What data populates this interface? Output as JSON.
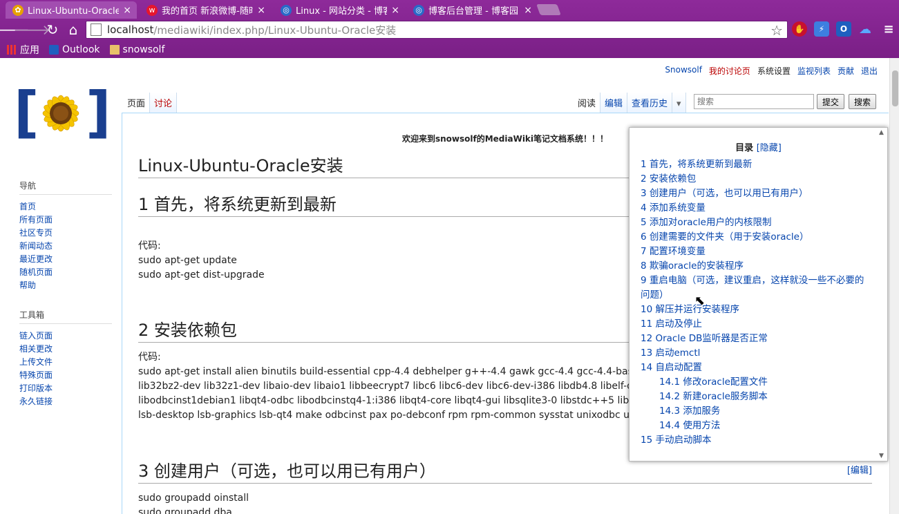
{
  "browser": {
    "tabs": [
      {
        "title": "Linux-Ubuntu-Oracle安装",
        "active": true,
        "icon": "mediawiki-sunflower-icon",
        "color": "#e6a100"
      },
      {
        "title": "我的首页 新浪微博-随时随地",
        "active": false,
        "icon": "weibo-icon",
        "color": "#e6162d"
      },
      {
        "title": "Linux - 网站分类 - 博客园",
        "active": false,
        "icon": "cnblogs-icon",
        "color": "#2a6ac8"
      },
      {
        "title": "博客后台管理 - 博客园",
        "active": false,
        "icon": "cnblogs-icon",
        "color": "#2a6ac8"
      }
    ],
    "url_host": "localhost",
    "url_path": "/mediawiki/index.php/Linux-Ubuntu-Oracle安装",
    "bookmarks": [
      "应用",
      "Outlook",
      "snowsolf"
    ],
    "accent": "#7a1f86"
  },
  "personal": {
    "user": "Snowsolf",
    "talk": "我的讨论页",
    "prefs": "系统设置",
    "watch": "监视列表",
    "contrib": "贡献",
    "logout": "退出"
  },
  "tabs": {
    "page": "页面",
    "talk": "讨论",
    "read": "阅读",
    "edit": "编辑",
    "history": "查看历史"
  },
  "search": {
    "placeholder": "搜索",
    "go": "提交",
    "search": "搜索"
  },
  "nav": {
    "heading": "导航",
    "items": [
      "首页",
      "所有页面",
      "社区专页",
      "新闻动态",
      "最近更改",
      "随机页面",
      "帮助"
    ]
  },
  "toolbox": {
    "heading": "工具箱",
    "items": [
      "链入页面",
      "相关更改",
      "上传文件",
      "特殊页面",
      "打印版本",
      "永久链接"
    ]
  },
  "article": {
    "sitenotice": "欢迎来到snowsolf的MediaWiki笔记文档系统！！！",
    "title": "Linux-Ubuntu-Oracle安装",
    "edit_label": "[编辑]",
    "s1_heading": "1 首先，将系统更新到最新",
    "s1_code_label": "代码:",
    "s1_line1": "sudo apt-get update",
    "s1_line2": "sudo apt-get dist-upgrade",
    "s2_heading": "2 安装依赖包",
    "s2_code_label": "代码:",
    "s2_body": "sudo apt-get install alien binutils build-essential cpp-4.4 debhelper g++-4.4 gawk gcc-4.4 gcc-4.4-base gettext html2text intltool-debian ksh lesstif2 lib32bz2-dev lib32z1-dev libaio-dev libaio1 libbeecrypt7 libc6 libc6-dev libc6-dev-i386 libdb4.8 libelf-dev libelf1 libltdl-dev libltdl7 libmotif4 libodbcinst1debian1 libqt4-odbc libodbcinstq4-1:i386 libqt4-core libqt4-gui libsqlite3-0 libstdc++5 libstdc++6 libstdc++6-4.4-dev lsb lsb-core lsb-cxx lsb-desktop lsb-graphics lsb-qt4 make odbcinst pax po-debconf rpm rpm-common sysstat unixodbc unixodbc-dev unzip",
    "s3_heading": "3 创建用户（可选，也可以用已有用户）",
    "s3_line1": "sudo groupadd oinstall",
    "s3_line2": "sudo groupadd dba"
  },
  "toc": {
    "title": "目录",
    "hide": "[隐藏]",
    "items": [
      {
        "text": "1 首先，将系统更新到最新",
        "sub": false
      },
      {
        "text": "2 安装依赖包",
        "sub": false
      },
      {
        "text": "3 创建用户（可选，也可以用已有用户）",
        "sub": false
      },
      {
        "text": "4 添加系统变量",
        "sub": false
      },
      {
        "text": "5 添加对oracle用户的内核限制",
        "sub": false
      },
      {
        "text": "6 创建需要的文件夹（用于安装oracle）",
        "sub": false
      },
      {
        "text": "7 配置环境变量",
        "sub": false
      },
      {
        "text": "8 欺骗oracle的安装程序",
        "sub": false
      },
      {
        "text": "9 重启电脑（可选，建议重启，这样就没一些不必要的问题）",
        "sub": false
      },
      {
        "text": "10 解压并运行安装程序",
        "sub": false
      },
      {
        "text": "11 启动及停止",
        "sub": false
      },
      {
        "text": "12 Oracle DB监听器是否正常",
        "sub": false
      },
      {
        "text": "13 启动emctl",
        "sub": false
      },
      {
        "text": "14 自启动配置",
        "sub": false
      },
      {
        "text": "14.1 修改oracle配置文件",
        "sub": true
      },
      {
        "text": "14.2 新建oracle服务脚本",
        "sub": true
      },
      {
        "text": "14.3 添加服务",
        "sub": true
      },
      {
        "text": "14.4 使用方法",
        "sub": true
      },
      {
        "text": "15 手动启动脚本",
        "sub": false
      }
    ]
  }
}
